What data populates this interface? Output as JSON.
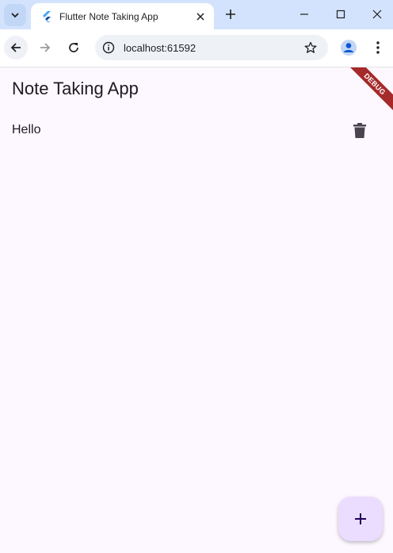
{
  "browser": {
    "tab_title": "Flutter Note Taking App",
    "url": "localhost:61592"
  },
  "app": {
    "title": "Note Taking App",
    "notes": [
      {
        "text": "Hello"
      }
    ],
    "debug_banner": "DEBUG"
  },
  "colors": {
    "tabstrip": "#d3e3fd",
    "app_background": "#fdf7ff",
    "fab": "#eaddff",
    "debug_banner": "#a52a2a",
    "profile_accent": "#0b57d0"
  }
}
